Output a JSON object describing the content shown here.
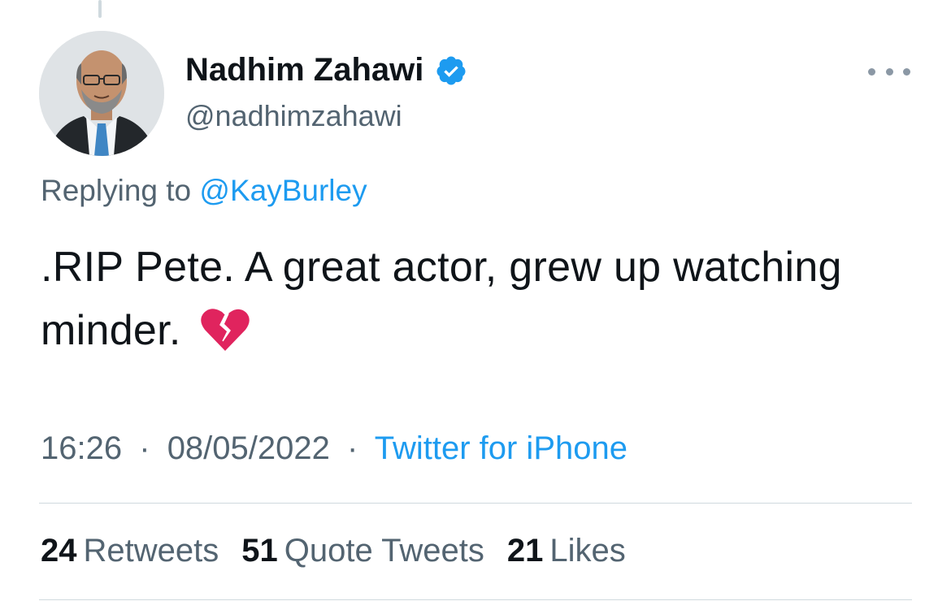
{
  "tweet": {
    "author": {
      "display_name": "Nadhim Zahawi",
      "handle": "@nadhimzahawi",
      "verified": true,
      "avatar_icon": "profile-photo",
      "verified_icon": "verified-badge-icon"
    },
    "reply_context": {
      "prefix": "Replying to",
      "mention": "@KayBurley"
    },
    "text": ".RIP Pete. A great actor, grew up watching minder.",
    "emoji_icon": "broken-heart-icon",
    "time": "16:26",
    "date": "08/05/2022",
    "separator": "·",
    "source": "Twitter for iPhone",
    "stats": [
      {
        "count": "24",
        "label": "Retweets"
      },
      {
        "count": "51",
        "label": "Quote Tweets"
      },
      {
        "count": "21",
        "label": "Likes"
      }
    ],
    "more_icon": "more-options-icon"
  },
  "colors": {
    "text_primary": "#0f1419",
    "text_secondary": "#536471",
    "accent": "#1d9bf0",
    "divider": "#cfd9de",
    "broken_heart": "#e0245e"
  }
}
